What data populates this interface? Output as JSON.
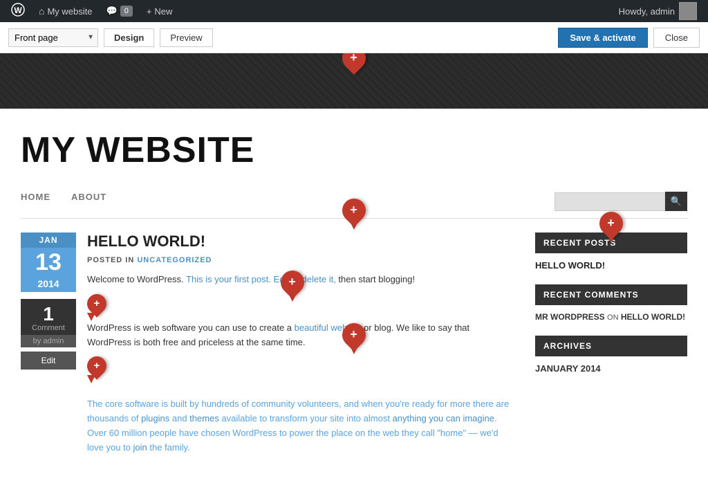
{
  "admin_bar": {
    "site_name": "My website",
    "comments_count": "0",
    "new_label": "New",
    "howdy_text": "Howdy, admin"
  },
  "toolbar": {
    "page_select_label": "Front page",
    "design_label": "Design",
    "preview_label": "Preview",
    "save_label": "Save & activate",
    "close_label": "Close"
  },
  "site": {
    "title": "MY WEBSITE",
    "nav": {
      "items": [
        {
          "label": "HOME"
        },
        {
          "label": "ABOUT"
        }
      ]
    },
    "search_placeholder": ""
  },
  "post": {
    "date": {
      "month": "JAN",
      "day": "13",
      "year": "2014"
    },
    "comment_count": "1",
    "comment_label": "Comment",
    "by_label": "by admin",
    "edit_label": "Edit",
    "title": "HELLO WORLD!",
    "posted_in_label": "POSTED IN",
    "category": "UNCATEGORIZED",
    "body1": "Welcome to WordPress. This is your first post. Edit or delete it, then start blogging!",
    "body2": "WordPress is web software you can use to create a beautiful website or blog. We like to say that WordPress is both free and priceless at the same time.",
    "body3": "The core software is built by hundreds of community volunteers, and when you're ready for more there are thousands of plugins and themes available to transform your site into almost anything you can imagine. Over 60 million people have chosen WordPress to power the place on the web they call \"home\" — we'd love you to join the family."
  },
  "sidebar": {
    "recent_posts_title": "RECENT POSTS",
    "recent_posts": [
      {
        "label": "HELLO WORLD!"
      }
    ],
    "recent_comments_title": "RECENT COMMENTS",
    "recent_comments": [
      {
        "commenter": "MR WORDPRESS",
        "on": "ON",
        "post": "HELLO WORLD!"
      }
    ],
    "archives_title": "ARCHIVES",
    "archives": [
      {
        "label": "JANUARY 2014"
      }
    ]
  },
  "icons": {
    "wp_logo": "⊞",
    "home_icon": "⌂",
    "comment_icon": "💬",
    "plus_icon": "+",
    "search_icon": "🔍"
  }
}
